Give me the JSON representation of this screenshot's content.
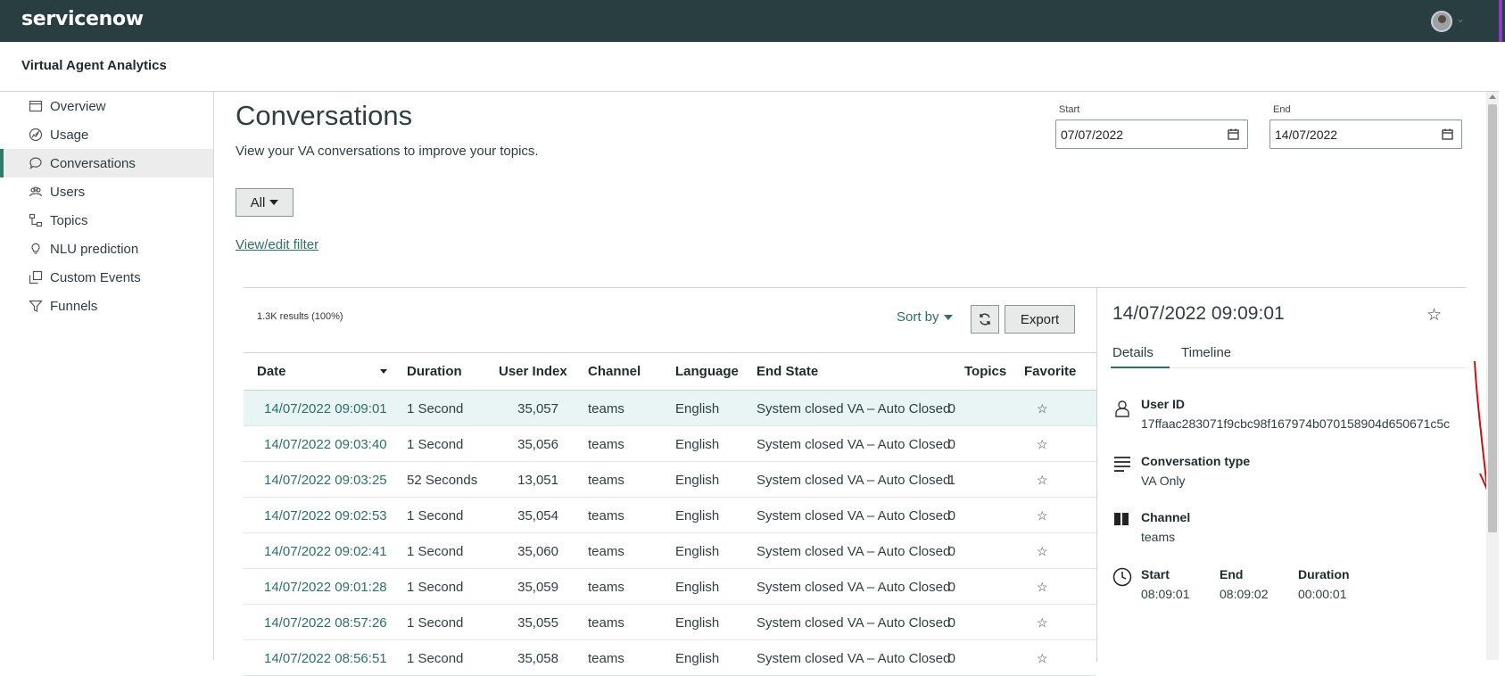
{
  "header": {
    "logo": "servicenow",
    "app_title": "Virtual Agent Analytics"
  },
  "sidebar": {
    "items": [
      {
        "label": "Overview",
        "icon": "overview-icon"
      },
      {
        "label": "Usage",
        "icon": "usage-icon"
      },
      {
        "label": "Conversations",
        "icon": "chat-icon",
        "active": true
      },
      {
        "label": "Users",
        "icon": "users-icon"
      },
      {
        "label": "Topics",
        "icon": "topics-icon"
      },
      {
        "label": "NLU prediction",
        "icon": "lightbulb-icon"
      },
      {
        "label": "Custom Events",
        "icon": "custom-events-icon"
      },
      {
        "label": "Funnels",
        "icon": "funnel-icon"
      }
    ]
  },
  "main": {
    "title": "Conversations",
    "subtitle": "View your VA conversations to improve your topics.",
    "filter_label": "All",
    "edit_filter": "View/edit filter",
    "start_label": "Start",
    "start_value": "07/07/2022",
    "end_label": "End",
    "end_value": "14/07/2022",
    "results": "1.3K results (100%)",
    "sort_by": "Sort by",
    "export": "Export"
  },
  "table": {
    "columns": [
      "Date",
      "Duration",
      "User Index",
      "Channel",
      "Language",
      "End State",
      "Topics",
      "Favorite"
    ],
    "rows": [
      [
        "14/07/2022 09:09:01",
        "1 Second",
        "35,057",
        "teams",
        "English",
        "System closed VA – Auto Closed",
        "0",
        "☆"
      ],
      [
        "14/07/2022 09:03:40",
        "1 Second",
        "35,056",
        "teams",
        "English",
        "System closed VA – Auto Closed",
        "0",
        "☆"
      ],
      [
        "14/07/2022 09:03:25",
        "52 Seconds",
        "13,051",
        "teams",
        "English",
        "System closed VA – Auto Closed",
        "1",
        "☆"
      ],
      [
        "14/07/2022 09:02:53",
        "1 Second",
        "35,054",
        "teams",
        "English",
        "System closed VA – Auto Closed",
        "0",
        "☆"
      ],
      [
        "14/07/2022 09:02:41",
        "1 Second",
        "35,060",
        "teams",
        "English",
        "System closed VA – Auto Closed",
        "0",
        "☆"
      ],
      [
        "14/07/2022 09:01:28",
        "1 Second",
        "35,059",
        "teams",
        "English",
        "System closed VA – Auto Closed",
        "0",
        "☆"
      ],
      [
        "14/07/2022 08:57:26",
        "1 Second",
        "35,055",
        "teams",
        "English",
        "System closed VA – Auto Closed",
        "0",
        "☆"
      ],
      [
        "14/07/2022 08:56:51",
        "1 Second",
        "35,058",
        "teams",
        "English",
        "System closed VA – Auto Closed",
        "0",
        "☆"
      ]
    ]
  },
  "detail": {
    "title": "14/07/2022 09:09:01",
    "tabs": [
      "Details",
      "Timeline"
    ],
    "user_id_label": "User ID",
    "user_id": "17ffaac283071f9cbc98f167974b070158904d650671c5c",
    "conv_type_label": "Conversation type",
    "conv_type": "VA Only",
    "channel_label": "Channel",
    "channel": "teams",
    "start_label": "Start",
    "start": "08:09:01",
    "end_label": "End",
    "end": "08:09:02",
    "duration_label": "Duration",
    "duration": "00:00:01"
  },
  "colors": {
    "topbar": "#293e40",
    "accent": "#2e6f68",
    "annotation": "#d01010"
  }
}
